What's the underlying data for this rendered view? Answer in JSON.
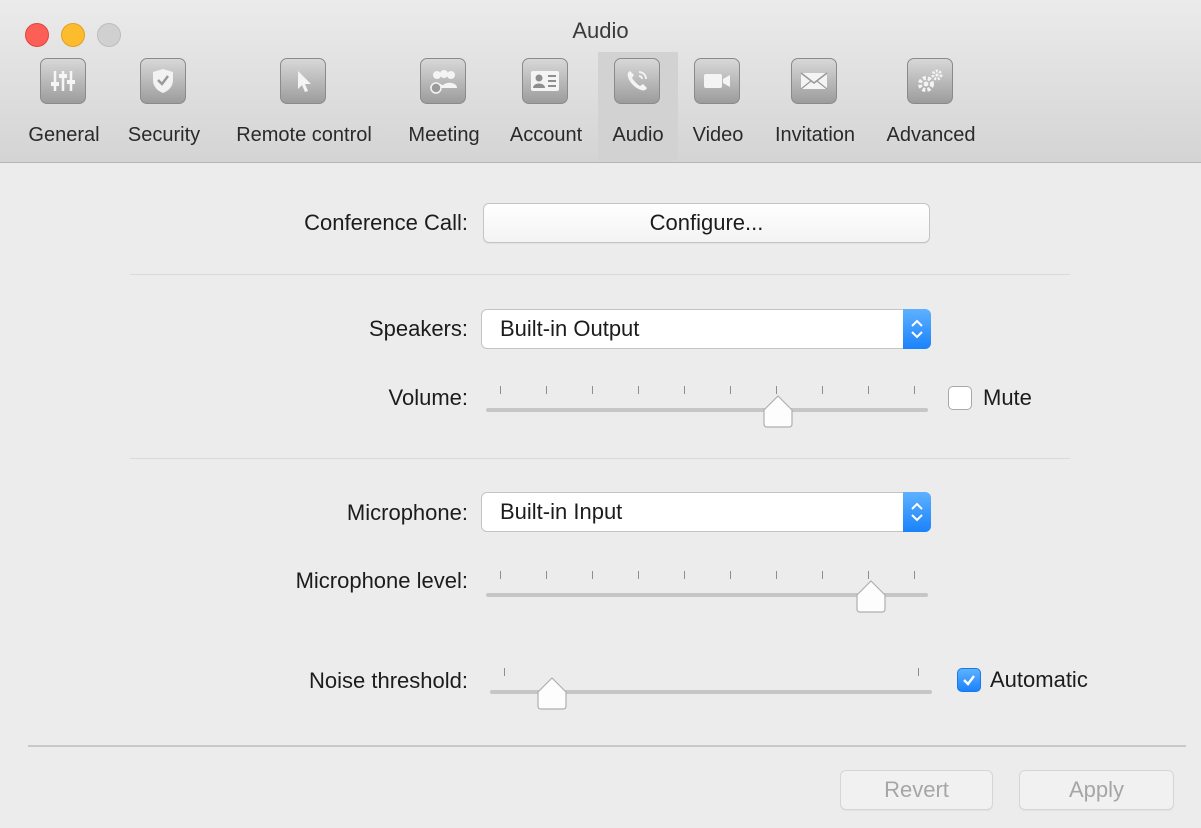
{
  "window": {
    "title": "Audio"
  },
  "toolbar": {
    "items": [
      {
        "label": "General",
        "icon": "sliders-icon"
      },
      {
        "label": "Security",
        "icon": "shield-icon"
      },
      {
        "label": "Remote control",
        "icon": "cursor-icon"
      },
      {
        "label": "Meeting",
        "icon": "people-icon"
      },
      {
        "label": "Account",
        "icon": "id-card-icon"
      },
      {
        "label": "Audio",
        "icon": "phone-icon"
      },
      {
        "label": "Video",
        "icon": "camera-icon"
      },
      {
        "label": "Invitation",
        "icon": "envelope-icon"
      },
      {
        "label": "Advanced",
        "icon": "gears-icon"
      }
    ],
    "selected": "Audio"
  },
  "conference": {
    "label": "Conference Call:",
    "button": "Configure..."
  },
  "speakers": {
    "label": "Speakers:",
    "selected": "Built-in Output",
    "volume_label": "Volume:",
    "volume_level": 0.66,
    "mute_label": "Mute",
    "muted": false
  },
  "microphone": {
    "label": "Microphone:",
    "selected": "Built-in Input",
    "level_label": "Microphone level:",
    "level": 0.87,
    "noise_label": "Noise threshold:",
    "noise_level": 0.14,
    "automatic_label": "Automatic",
    "automatic": true
  },
  "footer": {
    "revert": "Revert",
    "apply": "Apply"
  },
  "colors": {
    "accent": "#1a82fb",
    "toolbar_bg": "#d6d6d6",
    "window_bg": "#ececec"
  }
}
